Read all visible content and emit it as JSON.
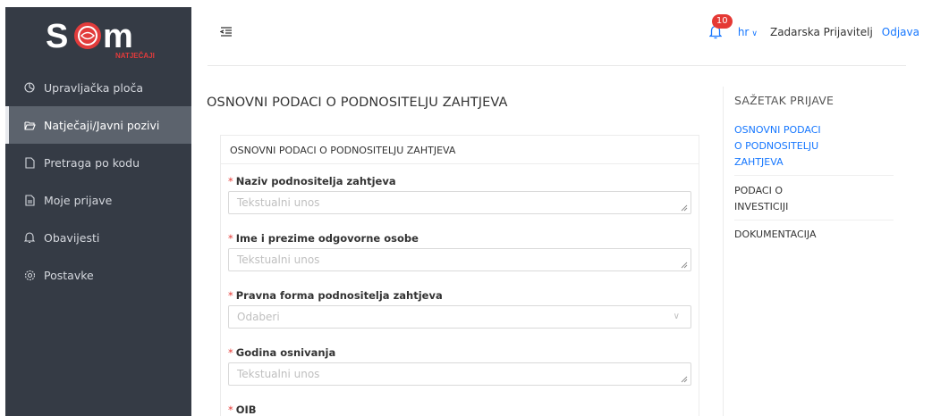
{
  "brand": {
    "logo_text": "NATJEČAJI"
  },
  "sidebar": {
    "items": [
      {
        "label": "Upravljačka ploča",
        "icon": "dashboard-icon"
      },
      {
        "label": "Natječaji/Javni pozivi",
        "icon": "folder-open-icon",
        "active": true
      },
      {
        "label": "Pretraga po kodu",
        "icon": "file-icon"
      },
      {
        "label": "Moje prijave",
        "icon": "file-text-icon"
      },
      {
        "label": "Obavijesti",
        "icon": "bell-icon"
      },
      {
        "label": "Postavke",
        "icon": "gear-icon"
      }
    ]
  },
  "header": {
    "notifications_count": "10",
    "language": "hr",
    "user_name": "Zadarska Prijavitelj",
    "logout_label": "Odjava"
  },
  "page": {
    "title": "OSNOVNI PODACI O PODNOSITELJU ZAHTJEVA"
  },
  "form": {
    "card_title": "OSNOVNI PODACI O PODNOSITELJU ZAHTJEVA",
    "fields": [
      {
        "label": "Naziv podnositelja zahtjeva",
        "placeholder": "Tekstualni unos",
        "type": "textarea",
        "required": true
      },
      {
        "label": "Ime i prezime odgovorne osobe",
        "placeholder": "Tekstualni unos",
        "type": "textarea",
        "required": true
      },
      {
        "label": "Pravna forma podnositelja zahtjeva",
        "placeholder": "Odaberi",
        "type": "select",
        "required": true
      },
      {
        "label": "Godina osnivanja",
        "placeholder": "Tekstualni unos",
        "type": "textarea",
        "required": true
      },
      {
        "label": "OIB",
        "placeholder": "",
        "type": "textarea",
        "required": true
      }
    ]
  },
  "summary": {
    "title": "SAŽETAK PRIJAVE",
    "items": [
      {
        "lines": [
          "OSNOVNI PODACI",
          "O PODNOSITELJU",
          "ZAHTJEVA"
        ],
        "active": true
      },
      {
        "lines": [
          "PODACI O",
          "INVESTICIJI"
        ],
        "active": false
      },
      {
        "lines": [
          "DOKUMENTACIJA"
        ],
        "active": false
      }
    ]
  },
  "colors": {
    "sidebar_bg": "#353b45",
    "sidebar_active_bg": "#5c636d",
    "accent": "#1677ff",
    "required": "#e53935",
    "badge": "#e53935",
    "logo_red": "#e23b3b"
  }
}
